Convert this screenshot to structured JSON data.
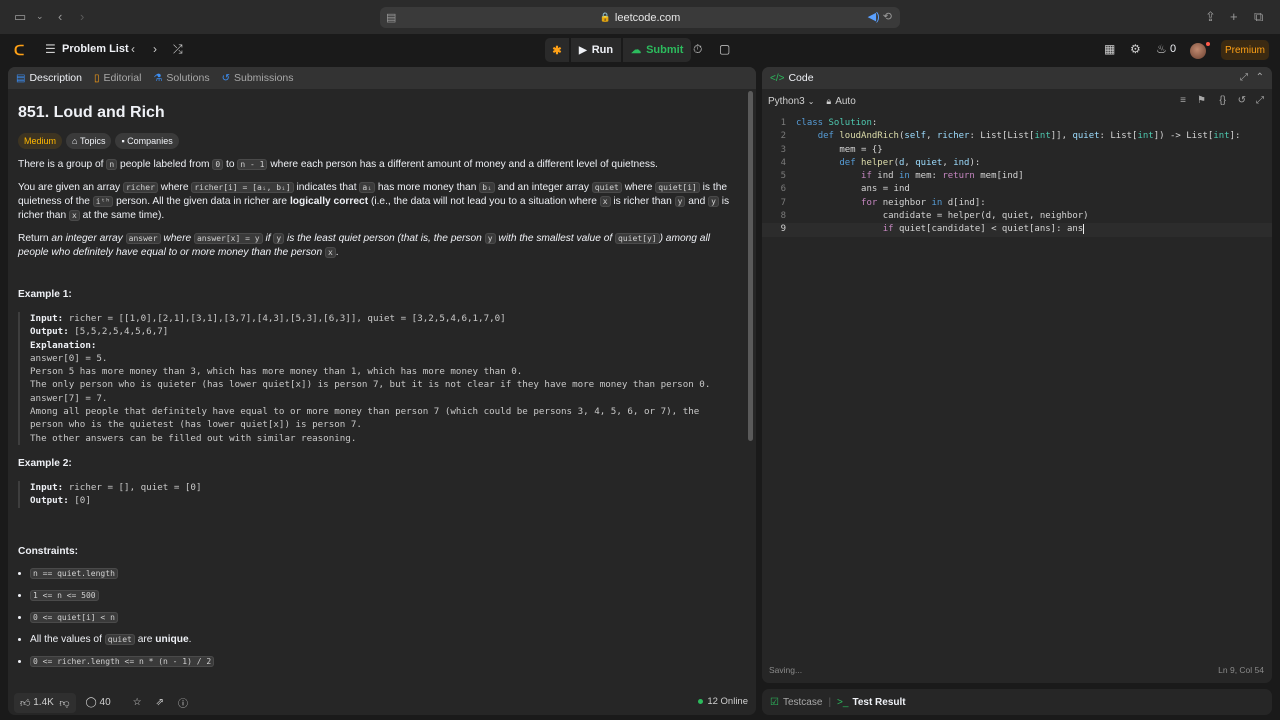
{
  "browser": {
    "url": "leetcode.com"
  },
  "navbar": {
    "problem_list": "Problem List",
    "run": "Run",
    "submit": "Submit",
    "streak": "0",
    "premium": "Premium"
  },
  "left_tabs": [
    "Description",
    "Editorial",
    "Solutions",
    "Submissions"
  ],
  "problem": {
    "title": "851. Loud and Rich",
    "difficulty": "Medium",
    "topics": "Topics",
    "companies": "Companies",
    "p1_a": "There is a group of",
    "p1_n": "n",
    "p1_b": "people labeled from",
    "p1_0": "0",
    "p1_c": "to",
    "p1_n1": "n - 1",
    "p1_d": "where each person has a different amount of money and a different level of quietness.",
    "p2_a": "You are given an array",
    "p2_richer": "richer",
    "p2_b": "where",
    "p2_code": "richer[i] = [aᵢ, bᵢ]",
    "p2_c": "indicates that",
    "p2_ai": "aᵢ",
    "p2_d": "has more money than",
    "p2_bi": "bᵢ",
    "p2_e": "and an integer array",
    "p2_quiet": "quiet",
    "p2_f": "where",
    "p2_qi": "quiet[i]",
    "p2_g": "is the quietness of the",
    "p2_ith": "iᵗʰ",
    "p2_h": "person. All the given data in richer are",
    "p2_bold": "logically correct",
    "p2_i": "(i.e., the data will not lead you to a situation where",
    "p2_x": "x",
    "p2_j": "is richer than",
    "p2_y": "y",
    "p2_k": "and",
    "p2_y2": "y",
    "p2_l": "is richer than",
    "p2_x2": "x",
    "p2_m": "at the same time).",
    "p3_a": "Return",
    "p3_b": "an integer array",
    "p3_answer": "answer",
    "p3_c": "where",
    "p3_code": "answer[x] = y",
    "p3_d": "if",
    "p3_y": "y",
    "p3_e": "is the least quiet person (that is, the person",
    "p3_y2": "y",
    "p3_f": "with the smallest value of",
    "p3_qy": "quiet[y]",
    "p3_g": ") among all people who definitely have equal to or more money than the person",
    "p3_x": "x",
    "p3_h": "."
  },
  "example1": {
    "heading": "Example 1:",
    "input_label": "Input:",
    "input": " richer = [[1,0],[2,1],[3,1],[3,7],[4,3],[5,3],[6,3]], quiet = [3,2,5,4,6,1,7,0]",
    "output_label": "Output:",
    "output": " [5,5,2,5,4,5,6,7]",
    "explanation_label": "Explanation:",
    "lines": [
      "answer[0] = 5.",
      "Person 5 has more money than 3, which has more money than 1, which has more money than 0.",
      "The only person who is quieter (has lower quiet[x]) is person 7, but it is not clear if they have more money than person 0.",
      "answer[7] = 7.",
      "Among all people that definitely have equal to or more money than person 7 (which could be persons 3, 4, 5, 6, or 7), the",
      "person who is the quietest (has lower quiet[x]) is person 7.",
      "The other answers can be filled out with similar reasoning."
    ]
  },
  "example2": {
    "heading": "Example 2:",
    "input_label": "Input:",
    "input": " richer = [], quiet = [0]",
    "output_label": "Output:",
    "output": " [0]"
  },
  "constraints": {
    "heading": "Constraints:",
    "c1": "n == quiet.length",
    "c2": "1 <= n <= 500",
    "c3": "0 <= quiet[i] < n",
    "c4_a": "All the values of",
    "c4_code": "quiet",
    "c4_b": "are",
    "c4_bold": "unique",
    "c4_c": ".",
    "c5": "0 <= richer.length <= n * (n - 1) / 2"
  },
  "bottom_left": {
    "likes": "1.4K",
    "comments": "40",
    "online": "12 Online"
  },
  "code_panel": {
    "title": "Code",
    "language": "Python3",
    "mode": "Auto",
    "line_numbers": [
      "1",
      "2",
      "3",
      "4",
      "5",
      "6",
      "7",
      "8",
      "9"
    ],
    "status": "Saving...",
    "cursor": "Ln 9, Col 54"
  },
  "bottom_tabs": {
    "testcase": "Testcase",
    "result": "Test Result"
  },
  "colors": {
    "accent": "#ffa116",
    "green": "#2cbb5d",
    "blue": "#3c8ff5"
  }
}
